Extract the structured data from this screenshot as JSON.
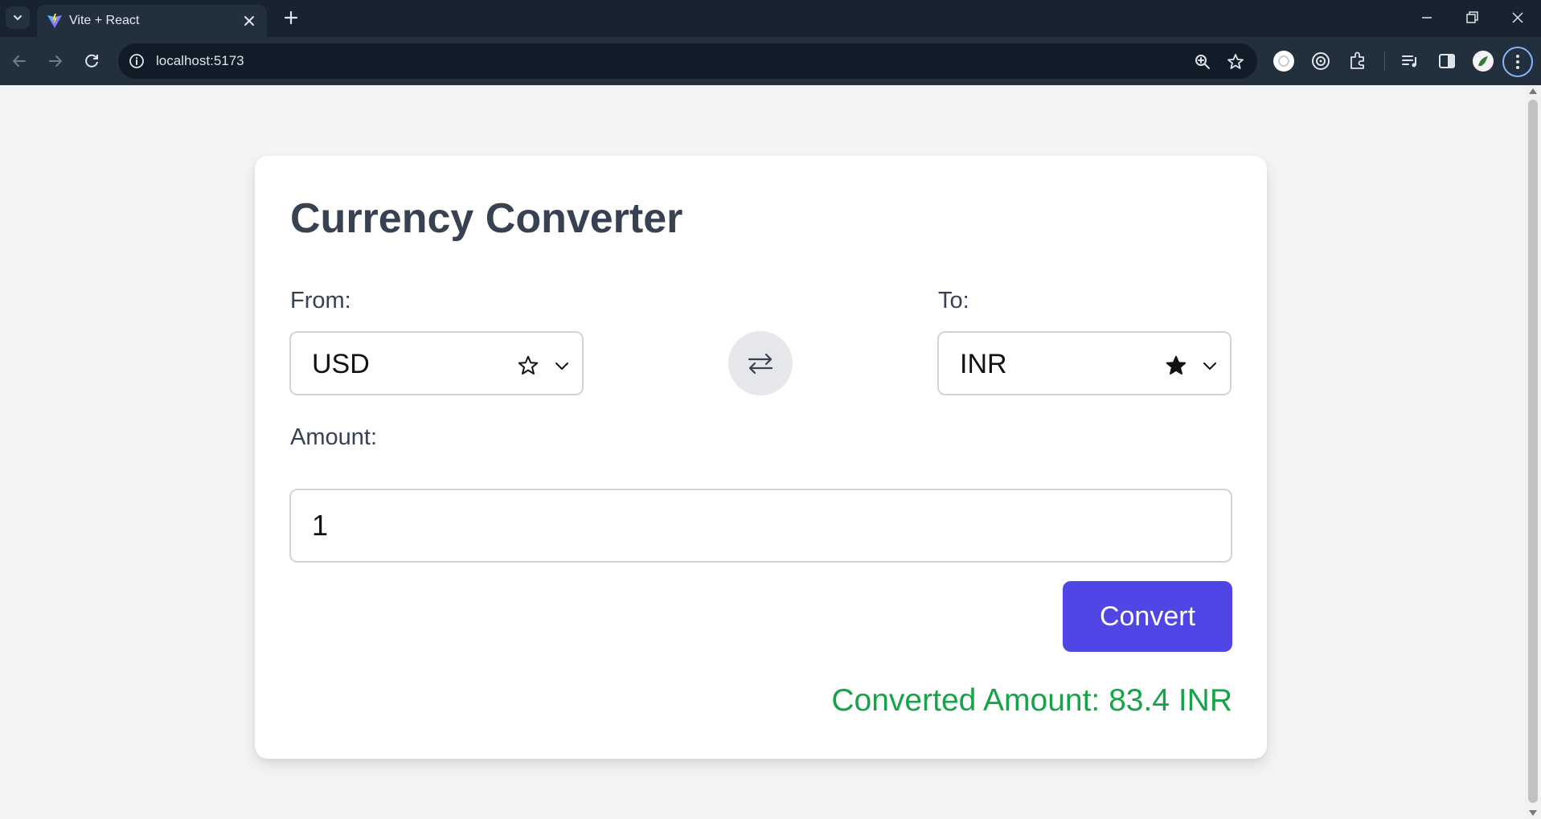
{
  "browser": {
    "tab_title": "Vite + React",
    "url": "localhost:5173"
  },
  "icons": {
    "tab_search": "chevron-down-icon",
    "favicon": "vite-logo-icon",
    "tab_close": "close-icon",
    "new_tab": "plus-icon",
    "back": "arrow-left-icon",
    "forward": "arrow-right-icon",
    "reload": "reload-icon",
    "site_info": "info-icon",
    "zoom": "zoom-icon",
    "bookmark": "star-outline-icon",
    "menu": "more-vertical-icon",
    "swap": "swap-arrows-icon",
    "from_favorite": "star-outline-icon",
    "to_favorite": "star-filled-icon"
  },
  "app": {
    "title": "Currency Converter",
    "from_label": "From:",
    "from_value": "USD",
    "from_favorite": false,
    "to_label": "To:",
    "to_value": "INR",
    "to_favorite": true,
    "amount_label": "Amount:",
    "amount_value": "1",
    "convert_label": "Convert",
    "result_text": "Converted Amount: 83.4 INR"
  },
  "colors": {
    "accent": "#4f46e5",
    "result": "#16a34a",
    "heading": "#374151",
    "page_bg": "#f3f4f6"
  }
}
